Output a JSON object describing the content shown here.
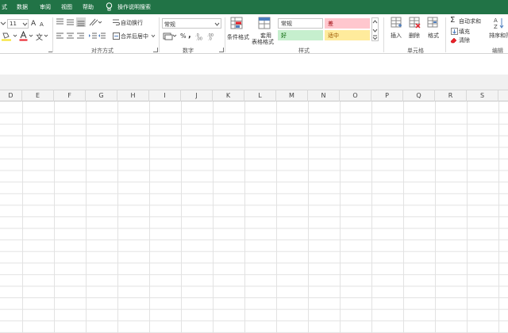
{
  "tabs": [
    "式",
    "数据",
    "审阅",
    "视图",
    "帮助",
    "操作说明搜索"
  ],
  "font": {
    "size": "11",
    "grow_label": "A",
    "shrink_label": "A",
    "phonetic_label": "文"
  },
  "alignment": {
    "wrap_label": "自动换行",
    "merge_label": "合并后居中",
    "group_label": "对齐方式"
  },
  "number": {
    "format_value": "常规",
    "percent": "%",
    "comma": ",",
    "group_label": "数字"
  },
  "styles": {
    "conditional_label": "条件格式",
    "table_label": "套用\n表格格式",
    "table_label_1": "套用",
    "table_label_2": "表格格式",
    "cells": [
      {
        "label": "常规",
        "bg": "#ffffff",
        "fg": "#333333"
      },
      {
        "label": "差",
        "bg": "#ffc7ce",
        "fg": "#9c0006"
      },
      {
        "label": "好",
        "bg": "#c6efce",
        "fg": "#006100"
      },
      {
        "label": "适中",
        "bg": "#ffeb9c",
        "fg": "#9c5700"
      }
    ],
    "group_label": "样式"
  },
  "cells_group": {
    "insert_label": "插入",
    "delete_label": "删除",
    "format_label": "格式",
    "group_label": "单元格"
  },
  "editing": {
    "autosum_label": "自动求和",
    "fill_label": "填充",
    "clear_label": "清除",
    "sort_label": "排序和筛",
    "group_label": "编辑"
  },
  "columns": [
    "D",
    "E",
    "F",
    "G",
    "H",
    "I",
    "J",
    "K",
    "L",
    "M",
    "N",
    "O",
    "P",
    "Q",
    "R",
    "S"
  ],
  "colors": {
    "accent": "#217346",
    "grid": "#e2e2e2"
  }
}
